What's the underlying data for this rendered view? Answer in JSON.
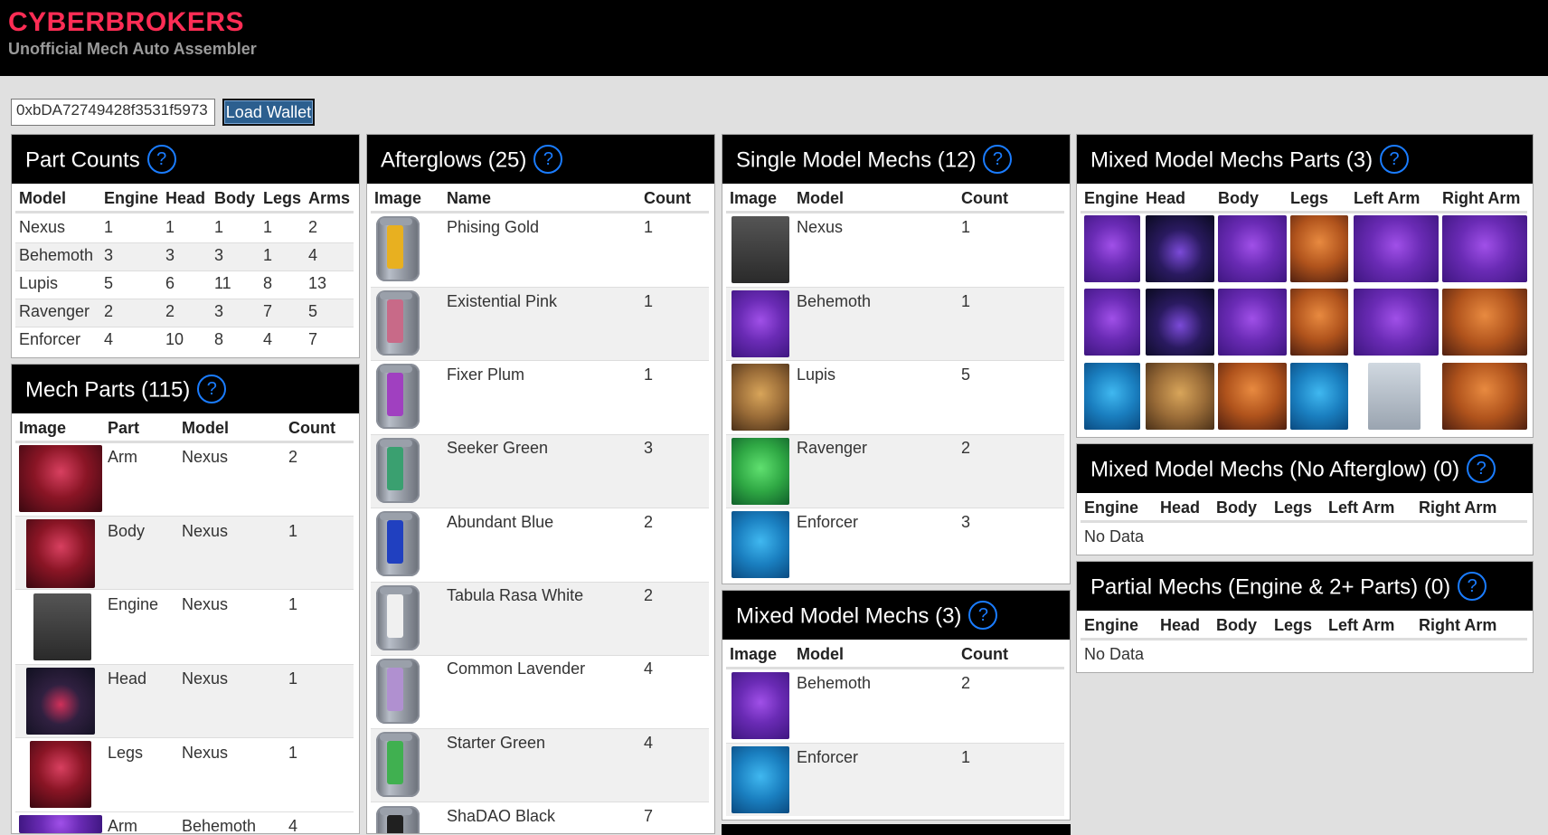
{
  "header": {
    "brand": "CYBERBROKERS",
    "subtitle": "Unofficial Mech Auto Assembler"
  },
  "wallet": {
    "value": "0xbDA72749428f3531f5973",
    "button": "Load Wallet"
  },
  "help_glyph": "?",
  "part_counts": {
    "title": "Part Counts",
    "columns": [
      "Model",
      "Engine",
      "Head",
      "Body",
      "Legs",
      "Arms"
    ],
    "rows": [
      [
        "Nexus",
        "1",
        "1",
        "1",
        "1",
        "2"
      ],
      [
        "Behemoth",
        "3",
        "3",
        "3",
        "1",
        "4"
      ],
      [
        "Lupis",
        "5",
        "6",
        "11",
        "8",
        "13"
      ],
      [
        "Ravenger",
        "2",
        "2",
        "3",
        "7",
        "5"
      ],
      [
        "Enforcer",
        "4",
        "10",
        "8",
        "4",
        "7"
      ]
    ]
  },
  "mech_parts": {
    "title": "Mech Parts (115)",
    "columns": [
      "Image",
      "Part",
      "Model",
      "Count"
    ],
    "rows": [
      {
        "part": "Arm",
        "model": "Nexus",
        "count": "2"
      },
      {
        "part": "Body",
        "model": "Nexus",
        "count": "1"
      },
      {
        "part": "Engine",
        "model": "Nexus",
        "count": "1"
      },
      {
        "part": "Head",
        "model": "Nexus",
        "count": "1"
      },
      {
        "part": "Legs",
        "model": "Nexus",
        "count": "1"
      },
      {
        "part": "Arm",
        "model": "Behemoth",
        "count": "4"
      }
    ]
  },
  "afterglows": {
    "title": "Afterglows (25)",
    "columns": [
      "Image",
      "Name",
      "Count"
    ],
    "rows": [
      {
        "name": "Phising Gold",
        "count": "1",
        "color": "#e8b020"
      },
      {
        "name": "Existential Pink",
        "count": "1",
        "color": "#c86a88"
      },
      {
        "name": "Fixer Plum",
        "count": "1",
        "color": "#a040c0"
      },
      {
        "name": "Seeker Green",
        "count": "3",
        "color": "#3aa070"
      },
      {
        "name": "Abundant Blue",
        "count": "2",
        "color": "#2040c0"
      },
      {
        "name": "Tabula Rasa White",
        "count": "2",
        "color": "#f0f0f0"
      },
      {
        "name": "Common Lavender",
        "count": "4",
        "color": "#b090d0"
      },
      {
        "name": "Starter Green",
        "count": "4",
        "color": "#40b050"
      },
      {
        "name": "ShaDAO Black",
        "count": "7",
        "color": "#202020"
      }
    ]
  },
  "single_model": {
    "title": "Single Model Mechs (12)",
    "columns": [
      "Image",
      "Model",
      "Count"
    ],
    "rows": [
      {
        "model": "Nexus",
        "count": "1"
      },
      {
        "model": "Behemoth",
        "count": "1"
      },
      {
        "model": "Lupis",
        "count": "5"
      },
      {
        "model": "Ravenger",
        "count": "2"
      },
      {
        "model": "Enforcer",
        "count": "3"
      }
    ]
  },
  "mixed_model": {
    "title": "Mixed Model Mechs (3)",
    "columns": [
      "Image",
      "Model",
      "Count"
    ],
    "rows": [
      {
        "model": "Behemoth",
        "count": "2"
      },
      {
        "model": "Enforcer",
        "count": "1"
      }
    ]
  },
  "mixed_parts": {
    "title": "Mixed Model Mechs Parts (3)",
    "columns": [
      "Engine",
      "Head",
      "Body",
      "Legs",
      "Left Arm",
      "Right Arm"
    ]
  },
  "mixed_no_afterglow": {
    "title": "Mixed Model Mechs (No Afterglow) (0)",
    "columns": [
      "Engine",
      "Head",
      "Body",
      "Legs",
      "Left Arm",
      "Right Arm"
    ],
    "empty": "No Data"
  },
  "partial": {
    "title": "Partial Mechs (Engine & 2+ Parts) (0)",
    "columns": [
      "Engine",
      "Head",
      "Body",
      "Legs",
      "Left Arm",
      "Right Arm"
    ],
    "empty": "No Data"
  }
}
